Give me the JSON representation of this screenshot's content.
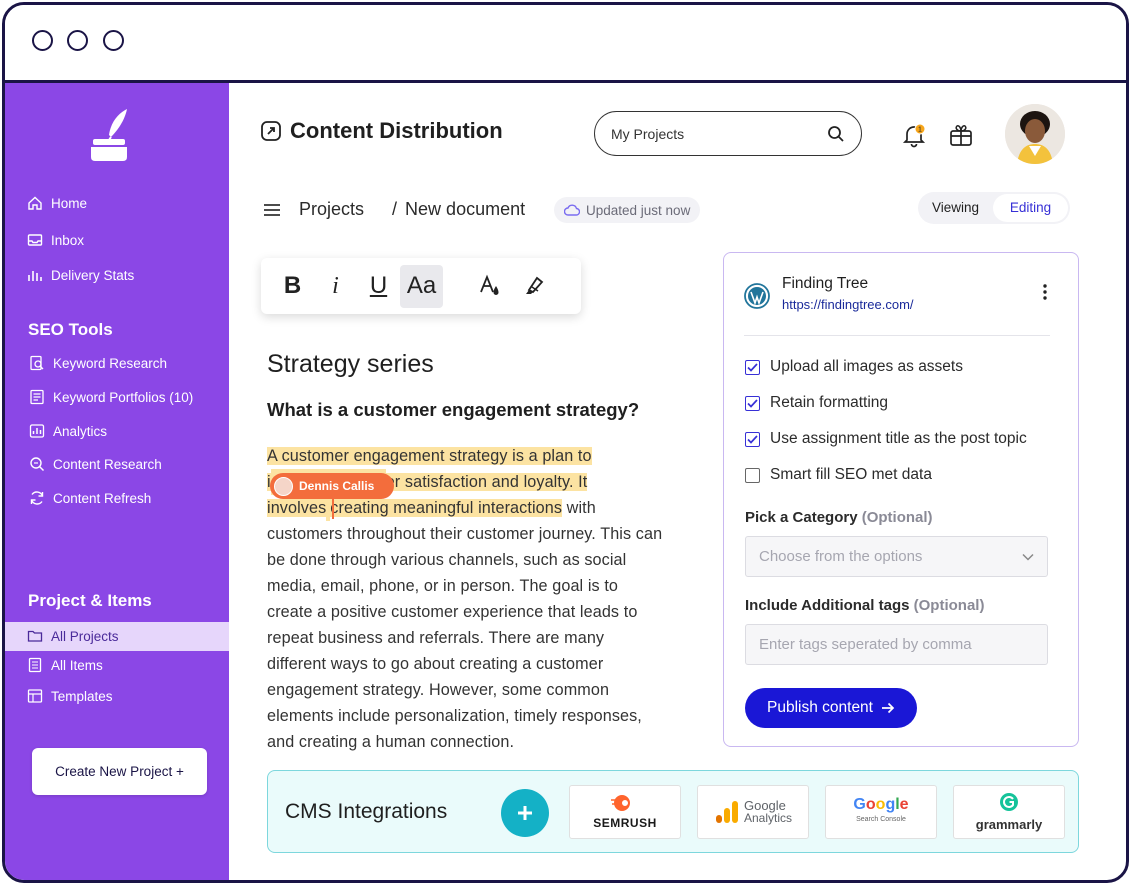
{
  "window": {
    "controls": [
      "close",
      "minimize",
      "maximize"
    ]
  },
  "colors": {
    "sidebar": "#8b47e6",
    "accent": "#1a17d6",
    "highlight": "#fce3a2",
    "collaborator": "#f36d3c",
    "cms_bg": "#eafbfb"
  },
  "sidebar": {
    "logo": "ink-quill-logo",
    "main": [
      {
        "label": "Home",
        "icon": "home-icon"
      },
      {
        "label": "Inbox",
        "icon": "inbox-icon"
      },
      {
        "label": "Delivery Stats",
        "icon": "bar-chart-icon"
      }
    ],
    "seo_title": "SEO Tools",
    "seo": [
      {
        "label": "Keyword Research",
        "icon": "keyword-research-icon"
      },
      {
        "label": "Keyword Portfolios (10)",
        "icon": "portfolio-icon"
      },
      {
        "label": "Analytics",
        "icon": "analytics-icon"
      },
      {
        "label": "Content Research",
        "icon": "content-research-icon"
      },
      {
        "label": "Content Refresh",
        "icon": "refresh-icon"
      }
    ],
    "projects_title": "Project & Items",
    "projects": [
      {
        "label": "All Projects",
        "icon": "folder-icon",
        "active": true
      },
      {
        "label": "All Items",
        "icon": "items-icon"
      },
      {
        "label": "Templates",
        "icon": "templates-icon"
      }
    ],
    "create_button": "Create New Project +"
  },
  "header": {
    "title": "Content Distribution",
    "search_value": "My Projects",
    "notifications_count": "1"
  },
  "breadcrumb": {
    "root": "Projects",
    "separator": "/",
    "current": "New document",
    "status": "Updated just now"
  },
  "mode": {
    "viewing": "Viewing",
    "editing": "Editing",
    "selected": "Editing"
  },
  "toolbar": {
    "bold": "B",
    "italic": "i",
    "underline": "U",
    "font": "Aa",
    "selected": "font"
  },
  "document": {
    "title": "Strategy series",
    "subtitle": "What is a customer engagement strategy?",
    "line1": "A customer engagement strategy is a plan to",
    "line2a": "i",
    "line2b": "er satisfaction and loyalty. It",
    "line3a": "involves",
    "line3b": "creating meaningful interactions",
    "line3c": " with",
    "rest": "customers throughout their customer journey. This can be done through various channels, such as social media, email, phone, or in person. The goal is to create a positive customer experience that leads to repeat business and referrals. There are many different ways to go about creating a customer engagement strategy. However, some common elements include personalization, timely responses, and creating a human connection.",
    "collaborator": "Dennis Callis"
  },
  "panel": {
    "site_name": "Finding Tree",
    "site_url": "https://findingtree.com/",
    "options": [
      {
        "label": "Upload all images as assets",
        "checked": true
      },
      {
        "label": "Retain formatting",
        "checked": true
      },
      {
        "label": "Use assignment title as the post topic",
        "checked": true
      },
      {
        "label": "Smart fill SEO met data",
        "checked": false
      }
    ],
    "category_label": "Pick a Category",
    "category_optional": "(Optional)",
    "category_placeholder": "Choose from the options",
    "tags_label": "Include Additional tags",
    "tags_optional": "(Optional)",
    "tags_placeholder": "Enter tags seperated by comma",
    "publish_label": "Publish content"
  },
  "cms": {
    "title": "CMS Integrations",
    "integrations": [
      {
        "name": "SEMRUSH"
      },
      {
        "name": "Google",
        "sub": "Analytics"
      },
      {
        "name": "Google",
        "sub": "Search Console"
      },
      {
        "name": "grammarly"
      }
    ]
  }
}
